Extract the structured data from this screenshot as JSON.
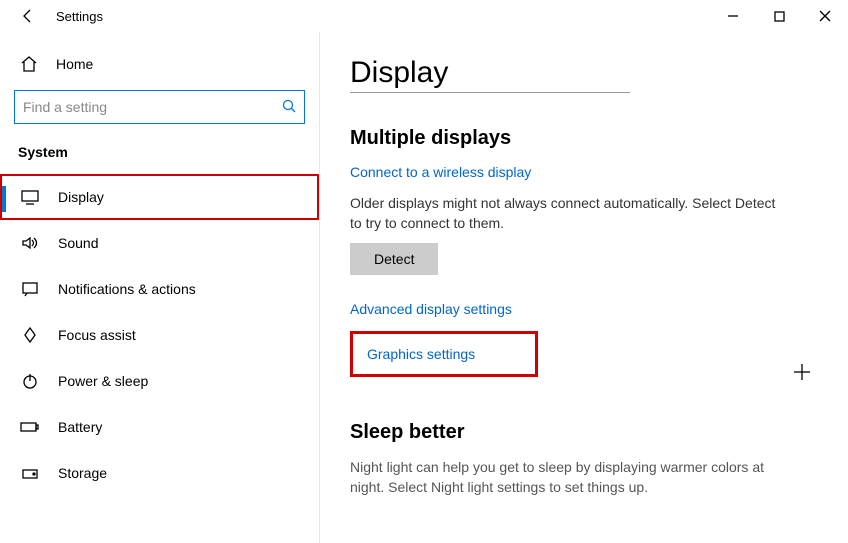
{
  "window": {
    "title": "Settings"
  },
  "sidebar": {
    "home": "Home",
    "search_placeholder": "Find a setting",
    "section": "System",
    "items": [
      {
        "label": "Display"
      },
      {
        "label": "Sound"
      },
      {
        "label": "Notifications & actions"
      },
      {
        "label": "Focus assist"
      },
      {
        "label": "Power & sleep"
      },
      {
        "label": "Battery"
      },
      {
        "label": "Storage"
      }
    ]
  },
  "main": {
    "heading": "Display",
    "multiple_displays": {
      "title": "Multiple displays",
      "connect_link": "Connect to a wireless display",
      "body": "Older displays might not always connect automatically. Select Detect to try to connect to them.",
      "detect_label": "Detect",
      "advanced_link": "Advanced display settings",
      "graphics_link": "Graphics settings"
    },
    "sleep_better": {
      "title": "Sleep better",
      "body": "Night light can help you get to sleep by displaying warmer colors at night. Select Night light settings to set things up."
    }
  }
}
